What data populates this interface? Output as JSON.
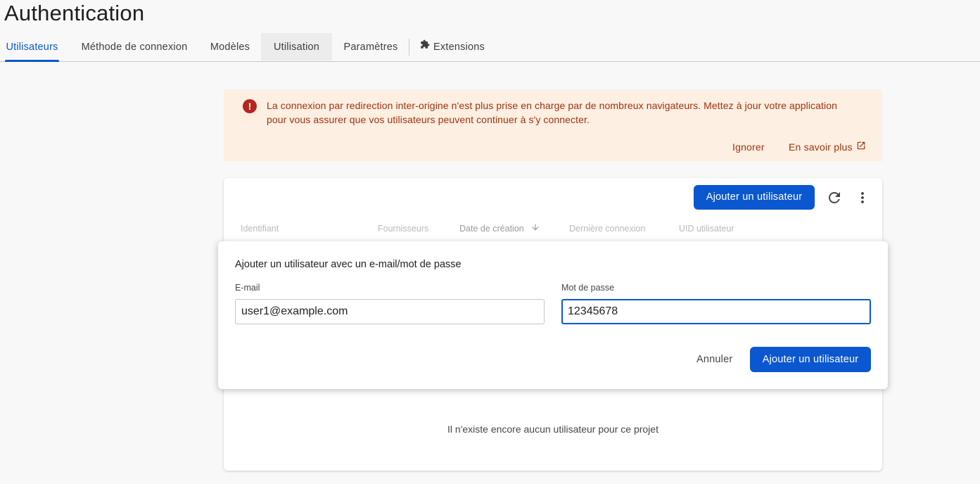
{
  "page": {
    "title": "Authentication"
  },
  "tabs": [
    {
      "label": "Utilisateurs",
      "active": true
    },
    {
      "label": "Méthode de connexion"
    },
    {
      "label": "Modèles"
    },
    {
      "label": "Utilisation"
    },
    {
      "label": "Paramètres"
    },
    {
      "label": "Extensions",
      "icon": "puzzle-piece-icon"
    }
  ],
  "banner": {
    "icon": "error-icon",
    "text": "La connexion par redirection inter-origine n'est plus prise en charge par de nombreux navigateurs. Mettez à jour votre application pour vous assurer que vos utilisateurs peuvent continuer à s'y connecter.",
    "dismiss_label": "Ignorer",
    "learn_more_label": "En savoir plus",
    "learn_more_icon": "open-in-new-icon",
    "color": "#a1320f",
    "background": "#fdefe1"
  },
  "users_table": {
    "add_user_label": "Ajouter un utilisateur",
    "refresh_icon": "refresh-icon",
    "more_icon": "more-vert-icon",
    "columns": [
      "Identifiant",
      "Fournisseurs",
      "Date de création",
      "Dernière connexion",
      "UID utilisateur"
    ],
    "sort_icon": "arrow-down-icon",
    "empty_message": "Il n'existe encore aucun utilisateur pour ce projet"
  },
  "add_user_dialog": {
    "title": "Ajouter un utilisateur avec un e-mail/mot de passe",
    "email_label": "E-mail",
    "email_value": "user1@example.com",
    "password_label": "Mot de passe",
    "password_value": "12345678",
    "cancel_label": "Annuler",
    "submit_label": "Ajouter un utilisateur"
  },
  "colors": {
    "accent": "#0b57d0",
    "error": "#b3261e"
  }
}
